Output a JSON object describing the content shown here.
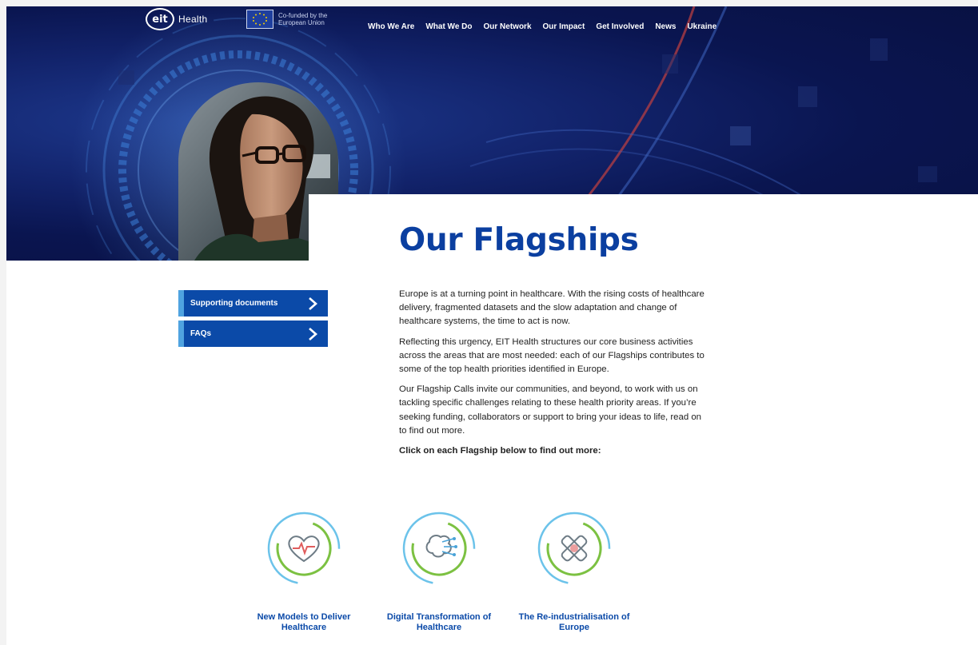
{
  "header": {
    "logo_circle_text": "eit",
    "logo_word": "Health",
    "eu_text": "Co-funded by the European Union",
    "nav": [
      "Who We Are",
      "What We Do",
      "Our Network",
      "Our Impact",
      "Get Involved",
      "News",
      "Ukraine"
    ]
  },
  "page": {
    "title": "Our Flagships"
  },
  "sidebar": {
    "items": [
      {
        "label": "Supporting documents"
      },
      {
        "label": "FAQs"
      }
    ]
  },
  "content": {
    "paragraphs": [
      "Europe is at a turning point in healthcare. With the rising costs of healthcare delivery, fragmented datasets and the slow adaptation and change of healthcare systems, the time to act is now.",
      "Reflecting this urgency, EIT Health structures our core business activities across the areas that are most needed: each of our Flagships contributes to some of the top health priorities identified in Europe.",
      "Our Flagship Calls invite our communities, and beyond, to work with us on tackling specific challenges relating to these health priority areas. If you’re seeking funding, collaborators or support to bring your ideas to life, read on to find out more."
    ],
    "cta": "Click on each Flagship below to find out more:"
  },
  "flagships": [
    {
      "label": "New Models to Deliver Healthcare",
      "icon": "heart-pulse-icon"
    },
    {
      "label": "Digital Transformation of Healthcare",
      "icon": "digital-brain-icon"
    },
    {
      "label": "The Re-industrialisation of Europe",
      "icon": "bandage-hand-icon"
    }
  ],
  "colors": {
    "brand_blue": "#0b4aa8",
    "accent_light_blue": "#4fa3e0",
    "ring_green": "#7cc142",
    "ring_blue": "#6cc3ea",
    "hero_navy": "#0a1550"
  }
}
